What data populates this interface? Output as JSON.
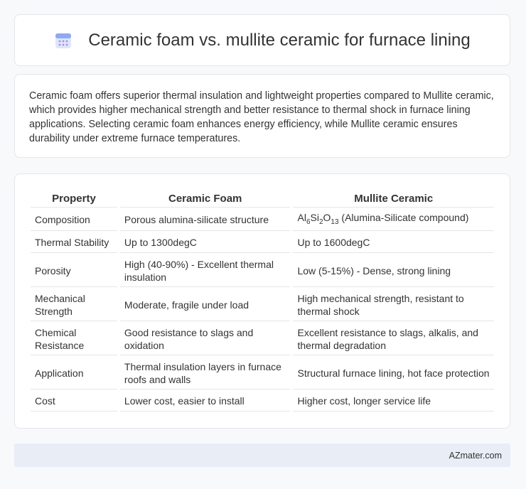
{
  "header": {
    "title": "Ceramic foam vs. mullite ceramic for furnace lining",
    "icon": "calendar-icon"
  },
  "intro": {
    "text": "Ceramic foam offers superior thermal insulation and lightweight properties compared to Mullite ceramic, which provides higher mechanical strength and better resistance to thermal shock in furnace lining applications. Selecting ceramic foam enhances energy efficiency, while Mullite ceramic ensures durability under extreme furnace temperatures."
  },
  "table": {
    "headers": [
      "Property",
      "Ceramic Foam",
      "Mullite Ceramic"
    ],
    "rows": [
      {
        "property": "Composition",
        "foam": "Porous alumina-silicate structure",
        "mullite": "Al6Si2O13 (Alumina-Silicate compound)"
      },
      {
        "property": "Thermal Stability",
        "foam": "Up to 1300degC",
        "mullite": "Up to 1600degC"
      },
      {
        "property": "Porosity",
        "foam": "High (40-90%) - Excellent thermal insulation",
        "mullite": "Low (5-15%) - Dense, strong lining"
      },
      {
        "property": "Mechanical Strength",
        "foam": "Moderate, fragile under load",
        "mullite": "High mechanical strength, resistant to thermal shock"
      },
      {
        "property": "Chemical Resistance",
        "foam": "Good resistance to slags and oxidation",
        "mullite": "Excellent resistance to slags, alkalis, and thermal degradation"
      },
      {
        "property": "Application",
        "foam": "Thermal insulation layers in furnace roofs and walls",
        "mullite": "Structural furnace lining, hot face protection"
      },
      {
        "property": "Cost",
        "foam": "Lower cost, easier to install",
        "mullite": "Higher cost, longer service life"
      }
    ]
  },
  "footer": {
    "brand": "AZmater.com"
  }
}
